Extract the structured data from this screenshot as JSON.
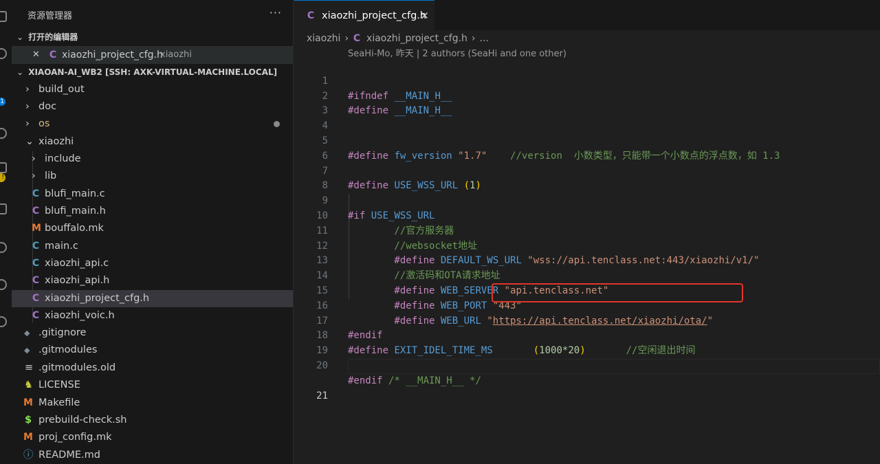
{
  "explorer": {
    "title": "资源管理器",
    "more": "···",
    "open_editors_label": "打开的编辑器",
    "open_editor": {
      "name": "xiaozhi_project_cfg.h",
      "folder": "xiaozhi",
      "close": "✕"
    },
    "workspace_label": "XIAOAN-AI_WB2 [SSH: AXK-VIRTUAL-MACHINE.LOCAL]",
    "tree": [
      {
        "name": "build_out",
        "type": "folder",
        "chevron": "›"
      },
      {
        "name": "doc",
        "type": "folder",
        "chevron": "›"
      },
      {
        "name": "os",
        "type": "folder",
        "chevron": "›",
        "modified": true
      },
      {
        "name": "xiaozhi",
        "type": "folder-open",
        "chevron": "⌄"
      },
      {
        "name": "include",
        "type": "folder",
        "chevron": "›"
      },
      {
        "name": "lib",
        "type": "folder",
        "chevron": "›"
      },
      {
        "name": "blufi_main.c",
        "icon": "C"
      },
      {
        "name": "blufi_main.h",
        "icon": "C"
      },
      {
        "name": "bouffalo.mk",
        "icon": "M"
      },
      {
        "name": "main.c",
        "icon": "C"
      },
      {
        "name": "xiaozhi_api.c",
        "icon": "C"
      },
      {
        "name": "xiaozhi_api.h",
        "icon": "C"
      },
      {
        "name": "xiaozhi_project_cfg.h",
        "icon": "C"
      },
      {
        "name": "xiaozhi_voic.h",
        "icon": "C"
      },
      {
        "name": ".gitignore",
        "icon": "◆"
      },
      {
        "name": ".gitmodules",
        "icon": "◆"
      },
      {
        "name": ".gitmodules.old",
        "icon": "≡"
      },
      {
        "name": "LICENSE",
        "icon": "♞"
      },
      {
        "name": "Makefile",
        "icon": "M"
      },
      {
        "name": "prebuild-check.sh",
        "icon": "$"
      },
      {
        "name": "proj_config.mk",
        "icon": "M"
      },
      {
        "name": "README.md",
        "icon": "ⓘ"
      }
    ]
  },
  "activity_bar": {
    "badge_count": "1",
    "warning": "!"
  },
  "editor": {
    "tab": {
      "label": "xiaozhi_project_cfg.h",
      "icon": "C",
      "close": "✕"
    },
    "breadcrumb": {
      "folder": "xiaozhi",
      "file": "xiaozhi_project_cfg.h",
      "tail": "...",
      "sep": "›"
    },
    "codelens": "SeaHi-Mo, 昨天 | 2 authors (SeaHi and one other)",
    "line_numbers": [
      "1",
      "2",
      "3",
      "4",
      "5",
      "6",
      "7",
      "8",
      "9",
      "10",
      "11",
      "12",
      "13",
      "14",
      "15",
      "16",
      "17",
      "18",
      "19",
      "20",
      "21"
    ],
    "lines": {
      "l1a": "#ifndef",
      "l1b": " __MAIN_H__",
      "l2a": "#define",
      "l2b": " __MAIN_H__",
      "l5a": "#define",
      "l5b": " fw_version",
      "l5c": " \"1.7\"",
      "l5d": "    //version  小数类型，只能带一个小数点的浮点数，如 1.3",
      "l7a": "#define",
      "l7b": " USE_WSS_URL",
      "l7c": " (",
      "l7d": "1",
      "l7e": ")",
      "l9a": "#if",
      "l9b": " USE_WSS_URL",
      "l10": "        //官方服务器",
      "l11": "        //websocket地址",
      "l12a": "        #define",
      "l12b": " DEFAULT_WS_URL",
      "l12c": " \"wss://api.tenclass.net:443/xiaozhi/v1/\"",
      "l13": "        //激活码和OTA请求地址",
      "l14a": "        #define",
      "l14b": " WEB_SERVER",
      "l14c": " \"api.tenclass.net\"",
      "l15a": "        #define",
      "l15b": " WEB_PORT",
      "l15c": " \"443\"",
      "l16a": "        #define",
      "l16b": " WEB_URL",
      "l16c": " \"",
      "l16d": "https://api.tenclass.net/xiaozhi/ota/",
      "l16e": "\"",
      "l17": "#endif",
      "l18a": "#define",
      "l18b": " EXIT_IDEL_TIME_MS",
      "l18c": "       (",
      "l18d": "1000*20",
      "l18e": ")",
      "l18f": "       //空闲退出时间",
      "l20a": "#endif",
      "l20b": " /* __MAIN_H__ */"
    }
  }
}
